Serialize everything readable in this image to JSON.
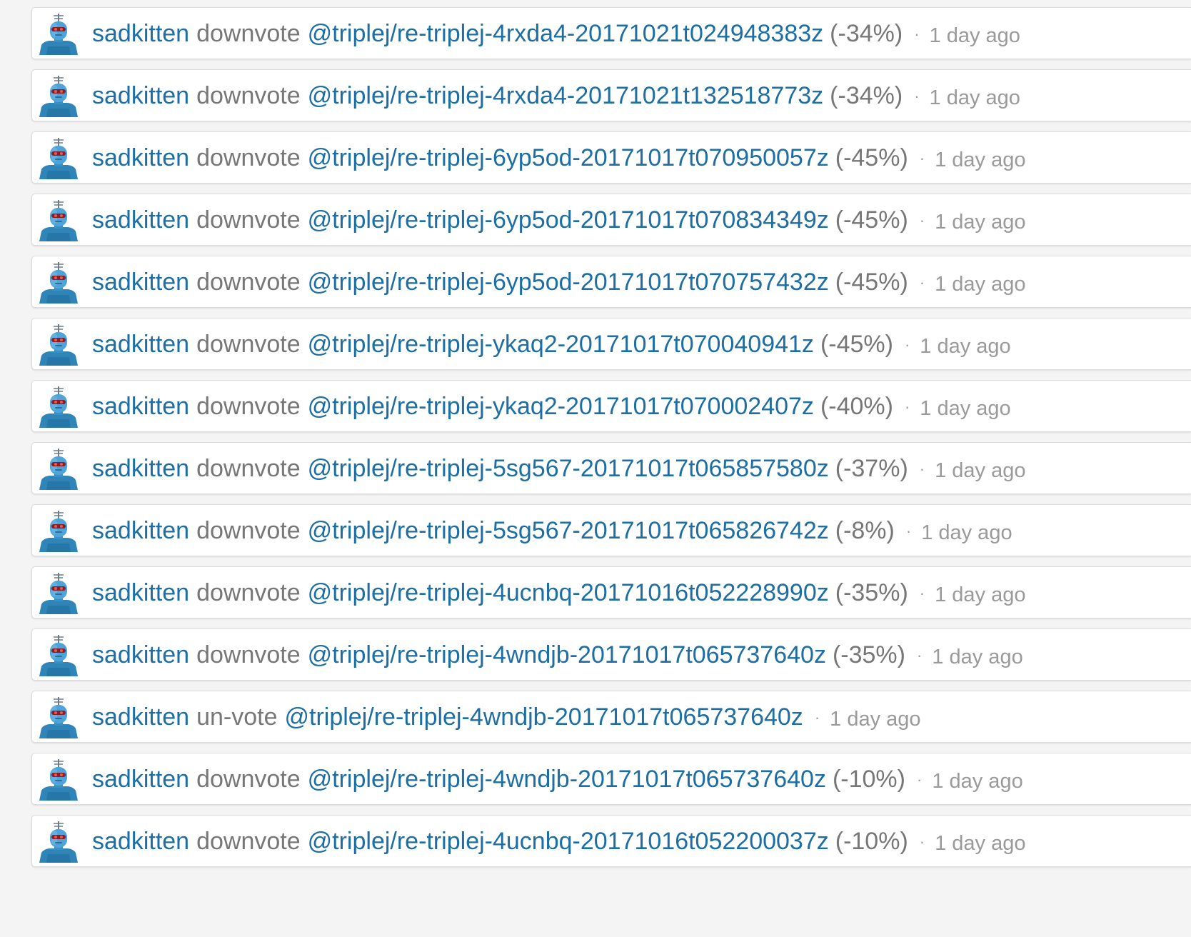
{
  "colors": {
    "link": "#1c6ea4",
    "muted_text": "#777777",
    "timestamp": "#9a9a9a",
    "page_background": "#f4f4f4",
    "card_background": "#ffffff"
  },
  "icons": {
    "avatar": "robot-avatar-icon"
  },
  "feed": {
    "items": [
      {
        "user": "sadkitten",
        "action": "downvote",
        "permlink": "@triplej/re-triplej-4rxda4-20171021t024948383z",
        "weight": "(-34%)",
        "separator": "·",
        "time": "1 day ago"
      },
      {
        "user": "sadkitten",
        "action": "downvote",
        "permlink": "@triplej/re-triplej-4rxda4-20171021t132518773z",
        "weight": "(-34%)",
        "separator": "·",
        "time": "1 day ago"
      },
      {
        "user": "sadkitten",
        "action": "downvote",
        "permlink": "@triplej/re-triplej-6yp5od-20171017t070950057z",
        "weight": "(-45%)",
        "separator": "·",
        "time": "1 day ago"
      },
      {
        "user": "sadkitten",
        "action": "downvote",
        "permlink": "@triplej/re-triplej-6yp5od-20171017t070834349z",
        "weight": "(-45%)",
        "separator": "·",
        "time": "1 day ago"
      },
      {
        "user": "sadkitten",
        "action": "downvote",
        "permlink": "@triplej/re-triplej-6yp5od-20171017t070757432z",
        "weight": "(-45%)",
        "separator": "·",
        "time": "1 day ago"
      },
      {
        "user": "sadkitten",
        "action": "downvote",
        "permlink": "@triplej/re-triplej-ykaq2-20171017t070040941z",
        "weight": "(-45%)",
        "separator": "·",
        "time": "1 day ago"
      },
      {
        "user": "sadkitten",
        "action": "downvote",
        "permlink": "@triplej/re-triplej-ykaq2-20171017t070002407z",
        "weight": "(-40%)",
        "separator": "·",
        "time": "1 day ago"
      },
      {
        "user": "sadkitten",
        "action": "downvote",
        "permlink": "@triplej/re-triplej-5sg567-20171017t065857580z",
        "weight": "(-37%)",
        "separator": "·",
        "time": "1 day ago"
      },
      {
        "user": "sadkitten",
        "action": "downvote",
        "permlink": "@triplej/re-triplej-5sg567-20171017t065826742z",
        "weight": "(-8%)",
        "separator": "·",
        "time": "1 day ago"
      },
      {
        "user": "sadkitten",
        "action": "downvote",
        "permlink": "@triplej/re-triplej-4ucnbq-20171016t052228990z",
        "weight": "(-35%)",
        "separator": "·",
        "time": "1 day ago"
      },
      {
        "user": "sadkitten",
        "action": "downvote",
        "permlink": "@triplej/re-triplej-4wndjb-20171017t065737640z",
        "weight": "(-35%)",
        "separator": "·",
        "time": "1 day ago"
      },
      {
        "user": "sadkitten",
        "action": "un-vote",
        "permlink": "@triplej/re-triplej-4wndjb-20171017t065737640z",
        "weight": "",
        "separator": "·",
        "time": "1 day ago"
      },
      {
        "user": "sadkitten",
        "action": "downvote",
        "permlink": "@triplej/re-triplej-4wndjb-20171017t065737640z",
        "weight": "(-10%)",
        "separator": "·",
        "time": "1 day ago"
      },
      {
        "user": "sadkitten",
        "action": "downvote",
        "permlink": "@triplej/re-triplej-4ucnbq-20171016t052200037z",
        "weight": "(-10%)",
        "separator": "·",
        "time": "1 day ago"
      }
    ]
  }
}
